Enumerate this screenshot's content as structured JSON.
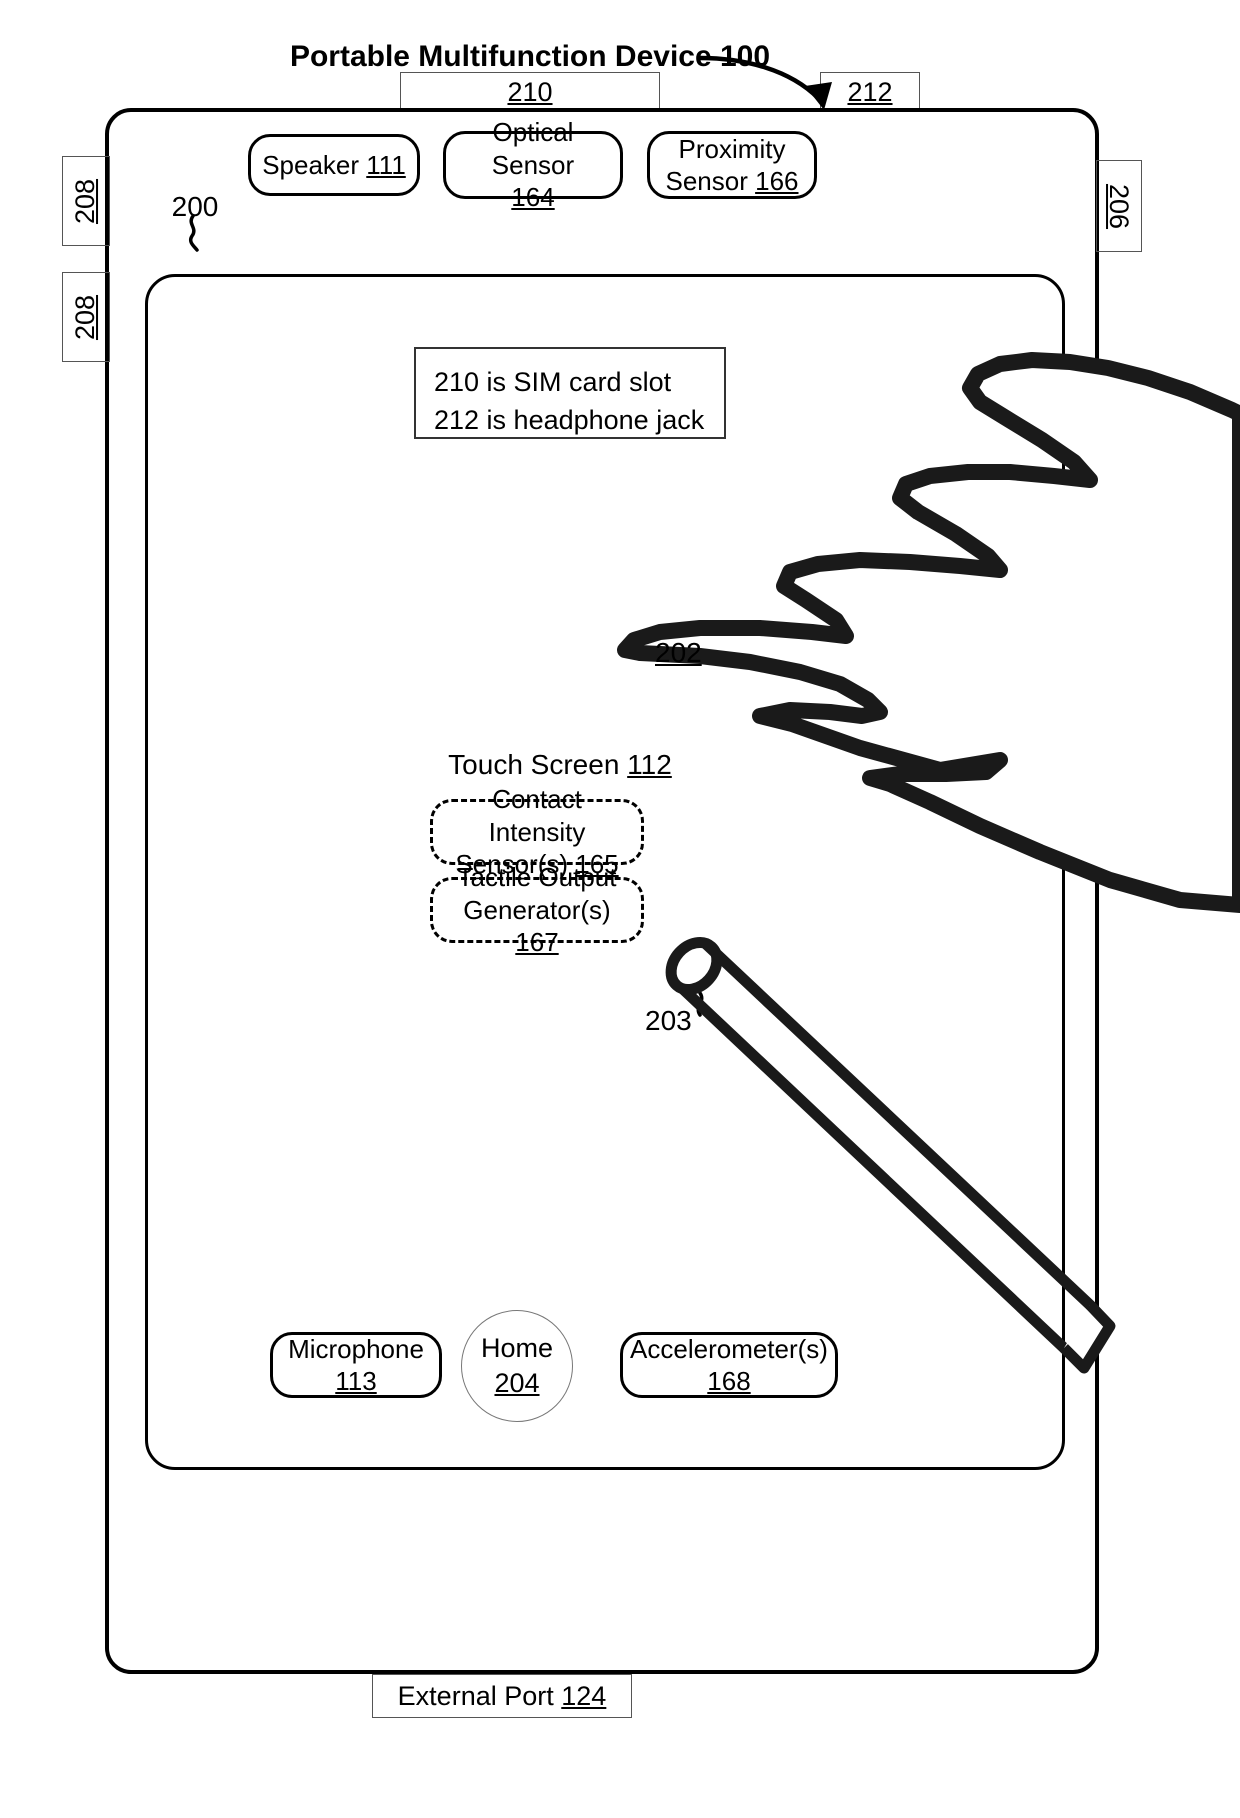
{
  "figure": {
    "title": "Portable Multifunction Device 100",
    "device_ref": "200",
    "stylus_ref": "203",
    "finger_ref": "202",
    "touch_screen_label": "Touch Screen",
    "touch_screen_ref": "112"
  },
  "note": {
    "line1": "210 is SIM card slot",
    "line2": "212 is headphone jack"
  },
  "top_components": [
    {
      "name": "speaker",
      "label": "Speaker",
      "ref": "111"
    },
    {
      "name": "optical-sensor",
      "label": "Optical Sensor",
      "ref": "164"
    },
    {
      "name": "proximity-sensor",
      "label": "Proximity Sensor",
      "ref": "166"
    }
  ],
  "bottom_components": [
    {
      "name": "microphone",
      "label": "Microphone",
      "ref": "113"
    },
    {
      "name": "home-button",
      "label": "Home",
      "ref": "204"
    },
    {
      "name": "accelerometer",
      "label": "Accelerometer(s)",
      "ref": "168"
    }
  ],
  "screen_components": [
    {
      "name": "contact-intensity-sensor",
      "line1": "Contact Intensity",
      "line2": "Sensor(s)",
      "ref": "165"
    },
    {
      "name": "tactile-output-generator",
      "line1": "Tactile Output",
      "line2": "Generator(s)",
      "ref": "167"
    }
  ],
  "callouts": {
    "sim_card_slot": "210",
    "headphone_jack": "212",
    "volume_button_upper": "208",
    "volume_button_lower": "208",
    "power_button": "206",
    "external_port_label": "External Port",
    "external_port_ref": "124"
  },
  "colors": {
    "ink": "#000000",
    "thin_line": "#555555",
    "paper": "#ffffff"
  }
}
